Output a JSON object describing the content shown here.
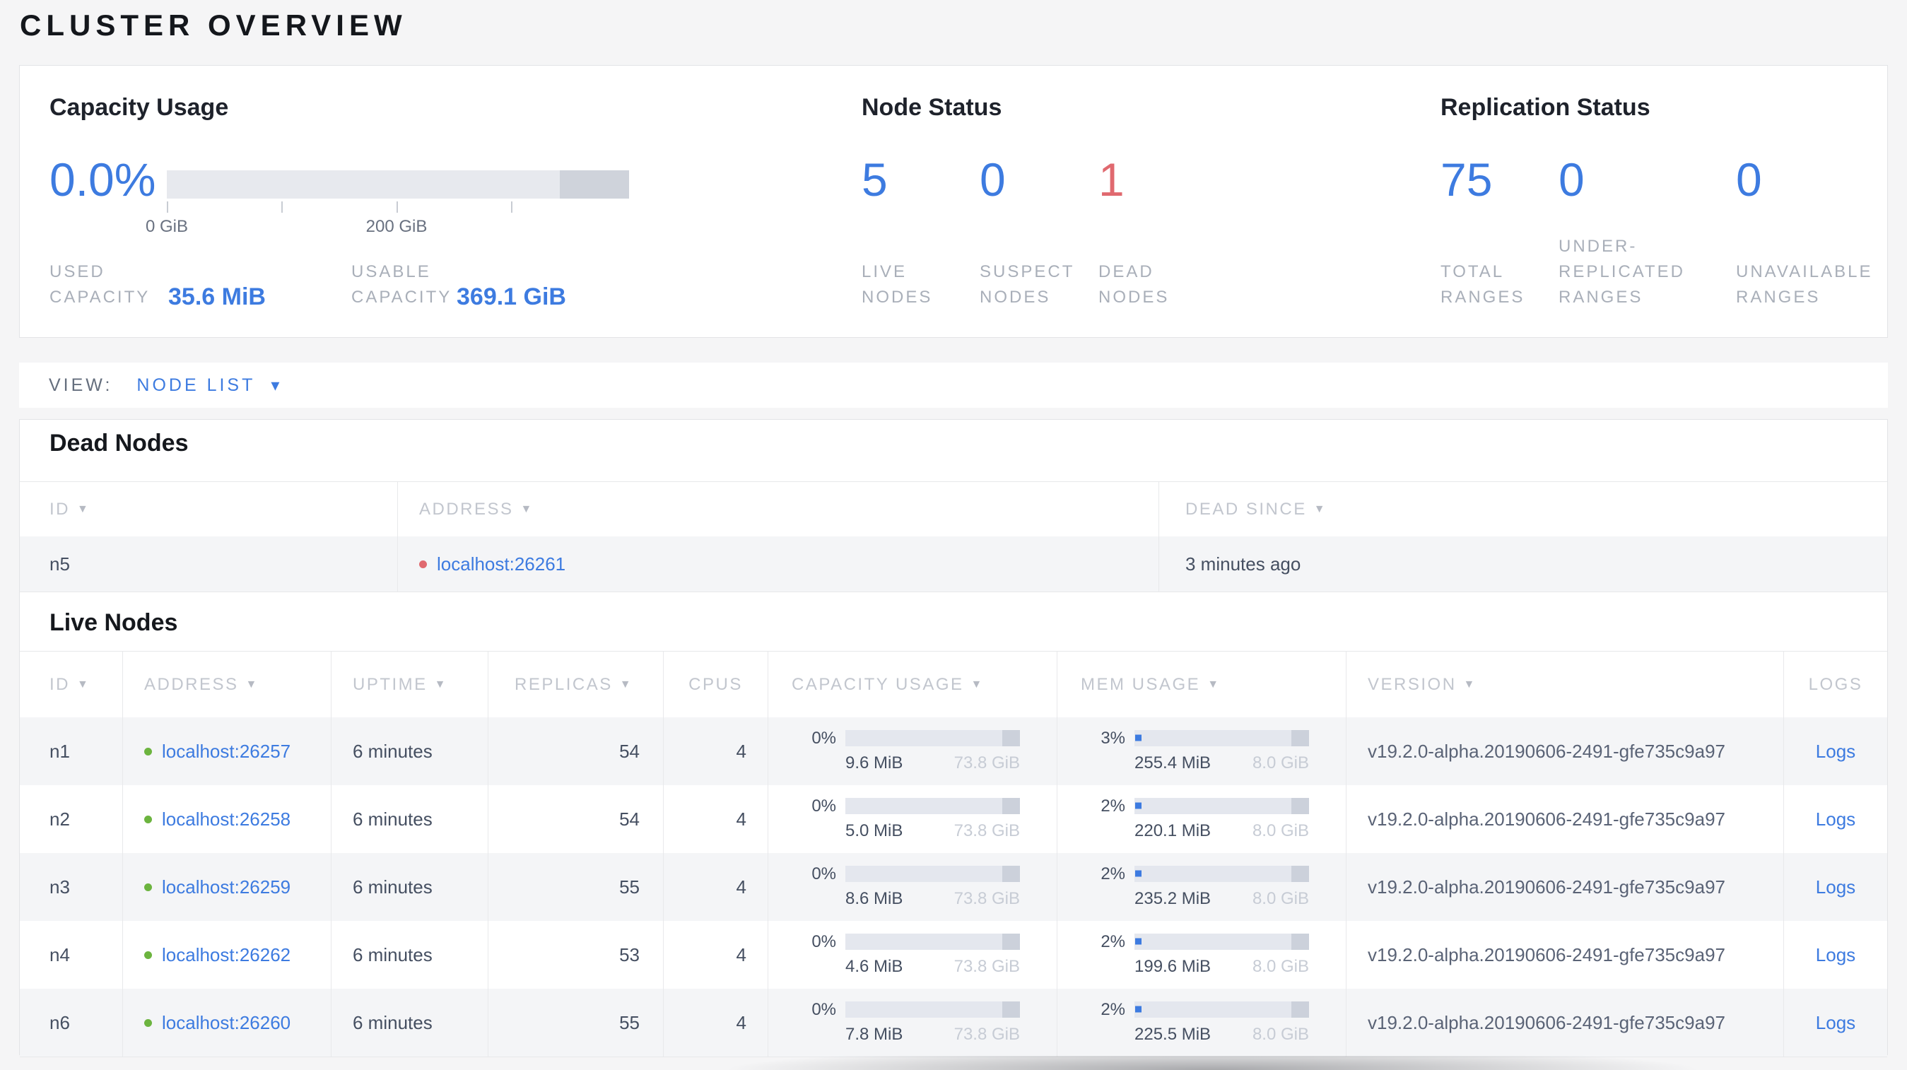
{
  "title": "CLUSTER OVERVIEW",
  "icons": {
    "sort_arrow": "▼",
    "dropdown_arrow": "▾"
  },
  "colors": {
    "accent_blue": "#3d7be0",
    "dead_red": "#e0696f",
    "live_green": "#6cb43f",
    "bar_track": "#e4e7ee",
    "bar_tail": "#ccd1db"
  },
  "summary": {
    "capacity": {
      "title": "Capacity Usage",
      "percent": "0.0%",
      "tick_labels": [
        "0 GiB",
        "200 GiB"
      ],
      "used": {
        "label_lines": [
          "USED",
          "CAPACITY"
        ],
        "value": "35.6 MiB"
      },
      "usable": {
        "label_lines": [
          "USABLE",
          "CAPACITY"
        ],
        "value": "369.1 GiB"
      }
    },
    "node_status": {
      "title": "Node Status",
      "stats": [
        {
          "value": "5",
          "label_lines": [
            "LIVE",
            "NODES"
          ]
        },
        {
          "value": "0",
          "label_lines": [
            "SUSPECT",
            "NODES"
          ]
        },
        {
          "value": "1",
          "label_lines": [
            "DEAD",
            "NODES"
          ]
        }
      ]
    },
    "replication": {
      "title": "Replication Status",
      "stats": [
        {
          "value": "75",
          "label_lines": [
            "TOTAL",
            "RANGES"
          ]
        },
        {
          "value": "0",
          "label_lines": [
            "UNDER-",
            "REPLICATED",
            "RANGES"
          ]
        },
        {
          "value": "0",
          "label_lines": [
            "UNAVAILABLE",
            "RANGES"
          ]
        }
      ]
    }
  },
  "view_bar": {
    "label": "VIEW:",
    "selected": "NODE LIST"
  },
  "dead_nodes": {
    "title": "Dead Nodes",
    "columns": [
      {
        "label": "ID"
      },
      {
        "label": "ADDRESS"
      },
      {
        "label": "DEAD SINCE"
      }
    ],
    "rows": [
      {
        "id": "n5",
        "address": "localhost:26261",
        "dead_since": "3 minutes ago"
      }
    ]
  },
  "live_nodes": {
    "title": "Live Nodes",
    "logs_label": "Logs",
    "columns": [
      {
        "label": "ID"
      },
      {
        "label": "ADDRESS"
      },
      {
        "label": "UPTIME"
      },
      {
        "label": "REPLICAS"
      },
      {
        "label": "CPUS"
      },
      {
        "label": "CAPACITY USAGE"
      },
      {
        "label": "MEM USAGE"
      },
      {
        "label": "VERSION"
      },
      {
        "label": "LOGS"
      }
    ],
    "rows": [
      {
        "id": "n1",
        "address": "localhost:26257",
        "uptime": "6 minutes",
        "replicas": "54",
        "cpus": "4",
        "capacity": {
          "percent": "0%",
          "used": "9.6 MiB",
          "total": "73.8 GiB"
        },
        "memory": {
          "percent": "3%",
          "used": "255.4 MiB",
          "total": "8.0 GiB"
        },
        "version": "v19.2.0-alpha.20190606-2491-gfe735c9a97"
      },
      {
        "id": "n2",
        "address": "localhost:26258",
        "uptime": "6 minutes",
        "replicas": "54",
        "cpus": "4",
        "capacity": {
          "percent": "0%",
          "used": "5.0 MiB",
          "total": "73.8 GiB"
        },
        "memory": {
          "percent": "2%",
          "used": "220.1 MiB",
          "total": "8.0 GiB"
        },
        "version": "v19.2.0-alpha.20190606-2491-gfe735c9a97"
      },
      {
        "id": "n3",
        "address": "localhost:26259",
        "uptime": "6 minutes",
        "replicas": "55",
        "cpus": "4",
        "capacity": {
          "percent": "0%",
          "used": "8.6 MiB",
          "total": "73.8 GiB"
        },
        "memory": {
          "percent": "2%",
          "used": "235.2 MiB",
          "total": "8.0 GiB"
        },
        "version": "v19.2.0-alpha.20190606-2491-gfe735c9a97"
      },
      {
        "id": "n4",
        "address": "localhost:26262",
        "uptime": "6 minutes",
        "replicas": "53",
        "cpus": "4",
        "capacity": {
          "percent": "0%",
          "used": "4.6 MiB",
          "total": "73.8 GiB"
        },
        "memory": {
          "percent": "2%",
          "used": "199.6 MiB",
          "total": "8.0 GiB"
        },
        "version": "v19.2.0-alpha.20190606-2491-gfe735c9a97"
      },
      {
        "id": "n6",
        "address": "localhost:26260",
        "uptime": "6 minutes",
        "replicas": "55",
        "cpus": "4",
        "capacity": {
          "percent": "0%",
          "used": "7.8 MiB",
          "total": "73.8 GiB"
        },
        "memory": {
          "percent": "2%",
          "used": "225.5 MiB",
          "total": "8.0 GiB"
        },
        "version": "v19.2.0-alpha.20190606-2491-gfe735c9a97"
      }
    ]
  }
}
